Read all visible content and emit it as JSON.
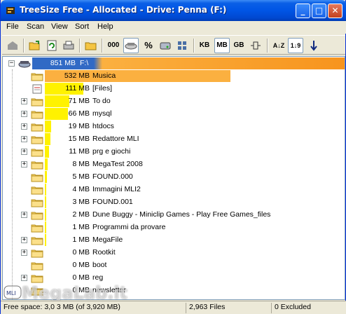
{
  "window": {
    "title": "TreeSize Free - Allocated - Drive: Penna (F:)",
    "min_glyph": "_",
    "max_glyph": "□",
    "close_glyph": "✕"
  },
  "menu": [
    "File",
    "Scan",
    "View",
    "Sort",
    "Help"
  ],
  "toolbar": {
    "count_label": "000",
    "percent_label": "%",
    "kb_label": "KB",
    "mb_label": "MB",
    "gb_label": "GB",
    "sort_az_label": "A↓Z",
    "sort_size_label": "1↓9",
    "icons": [
      "up-folder-icon",
      "open-folder-icon",
      "refresh-icon",
      "print-icon",
      "folder-open-icon",
      "count-icon",
      "size-icon",
      "percent-icon",
      "drive-icon",
      "grid-icon",
      "kb-icon",
      "mb-icon",
      "gb-icon",
      "expand-icon",
      "sort-name-icon",
      "sort-size-icon",
      "sort-down-icon"
    ]
  },
  "tree": {
    "root": {
      "size": "851 MB",
      "name": "F:\\",
      "percent": 100
    },
    "items": [
      {
        "size": "532 MB",
        "name": "Musica",
        "percent": 62.5,
        "expander": false,
        "icon": "folder"
      },
      {
        "size": "111 MB",
        "name": "[Files]",
        "percent": 13.0,
        "expander": false,
        "icon": "files"
      },
      {
        "size": "71 MB",
        "name": "To do",
        "percent": 8.3,
        "expander": true,
        "icon": "folder"
      },
      {
        "size": "66 MB",
        "name": "mysql",
        "percent": 7.8,
        "expander": true,
        "icon": "folder"
      },
      {
        "size": "19 MB",
        "name": "htdocs",
        "percent": 2.2,
        "expander": true,
        "icon": "folder"
      },
      {
        "size": "15 MB",
        "name": "Redattore MLI",
        "percent": 1.8,
        "expander": true,
        "icon": "folder"
      },
      {
        "size": "11 MB",
        "name": "prg e giochi",
        "percent": 1.3,
        "expander": true,
        "icon": "folder"
      },
      {
        "size": "8 MB",
        "name": "MegaTest 2008",
        "percent": 0.9,
        "expander": true,
        "icon": "folder"
      },
      {
        "size": "5 MB",
        "name": "FOUND.000",
        "percent": 0.6,
        "expander": false,
        "icon": "folder"
      },
      {
        "size": "4 MB",
        "name": "Immagini MLI2",
        "percent": 0.5,
        "expander": false,
        "icon": "folder"
      },
      {
        "size": "3 MB",
        "name": "FOUND.001",
        "percent": 0.4,
        "expander": false,
        "icon": "folder"
      },
      {
        "size": "2 MB",
        "name": "Dune Buggy - Miniclip Games - Play Free Games_files",
        "percent": 0.2,
        "expander": true,
        "icon": "folder"
      },
      {
        "size": "1 MB",
        "name": "Programmi da provare",
        "percent": 0.1,
        "expander": false,
        "icon": "folder"
      },
      {
        "size": "1 MB",
        "name": "MegaFile",
        "percent": 0.1,
        "expander": true,
        "icon": "folder"
      },
      {
        "size": "0 MB",
        "name": "Rootkit",
        "percent": 0,
        "expander": true,
        "icon": "folder"
      },
      {
        "size": "0 MB",
        "name": "boot",
        "percent": 0,
        "expander": false,
        "icon": "folder"
      },
      {
        "size": "0 MB",
        "name": "reg",
        "percent": 0,
        "expander": true,
        "icon": "folder"
      },
      {
        "size": "0 MB",
        "name": "newsletter",
        "percent": 0,
        "expander": false,
        "icon": "folder"
      }
    ]
  },
  "status": {
    "free_space": "Free space: 3,0 3 MB (of 3,920 MB)",
    "files": "2,963  Files",
    "excluded": "0 Excluded"
  },
  "watermark": {
    "text": "MegaLab.it",
    "badge": "MLI"
  },
  "colors": {
    "root_bar": "#f7941d",
    "musica_bar": "#fbb040",
    "small_bar": "#fff200",
    "selection": "#316ac5"
  }
}
